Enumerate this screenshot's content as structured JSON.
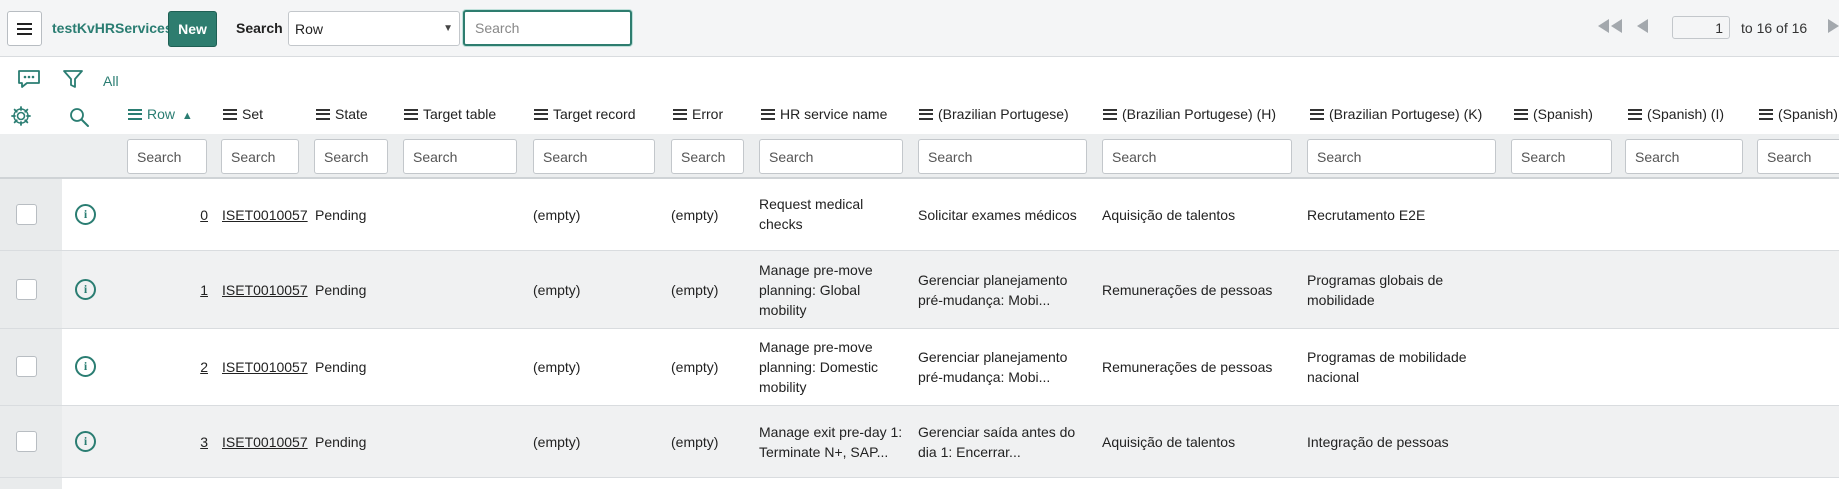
{
  "header": {
    "title": "testKvHRServices",
    "new_label": "New",
    "search_label": "Search",
    "search_field": "Row",
    "search_placeholder": "Search",
    "page_value": "1",
    "page_count": "to 16 of 16"
  },
  "filter": {
    "all_label": "All"
  },
  "columns": [
    {
      "label": "Row",
      "sorted": "asc"
    },
    {
      "label": "Set"
    },
    {
      "label": "State"
    },
    {
      "label": "Target table"
    },
    {
      "label": "Target record"
    },
    {
      "label": "Error"
    },
    {
      "label": "HR service name"
    },
    {
      "label": "(Brazilian Portugese)"
    },
    {
      "label": "(Brazilian Portugese) (H)"
    },
    {
      "label": "(Brazilian Portugese) (K)"
    },
    {
      "label": "(Spanish)"
    },
    {
      "label": "(Spanish) (I)"
    },
    {
      "label": "(Spanish)"
    }
  ],
  "sort_indicator": "▲",
  "column_search_placeholder": "Search",
  "rows": [
    {
      "row": "0",
      "set": "ISET0010057",
      "state": "Pending",
      "target_record": "(empty)",
      "error": "(empty)",
      "name": [
        "Request medical",
        "checks"
      ],
      "br": [
        "Solicitar exames médicos"
      ],
      "br_h": "Aquisição de talentos",
      "br_k": [
        "Recrutamento E2E"
      ]
    },
    {
      "row": "1",
      "set": "ISET0010057",
      "state": "Pending",
      "target_record": "(empty)",
      "error": "(empty)",
      "name": [
        "Manage pre-move",
        "planning: Global",
        "mobility"
      ],
      "br": [
        "Gerenciar planejamento",
        "pré-mudança: Mobi..."
      ],
      "br_h": "Remunerações de pessoas",
      "br_k": [
        "Programas globais de",
        "mobilidade"
      ]
    },
    {
      "row": "2",
      "set": "ISET0010057",
      "state": "Pending",
      "target_record": "(empty)",
      "error": "(empty)",
      "name": [
        "Manage pre-move",
        "planning: Domestic",
        "mobility"
      ],
      "br": [
        "Gerenciar planejamento",
        "pré-mudança: Mobi..."
      ],
      "br_h": "Remunerações de pessoas",
      "br_k": [
        "Programas de mobilidade",
        "nacional"
      ]
    },
    {
      "row": "3",
      "set": "ISET0010057",
      "state": "Pending",
      "target_record": "(empty)",
      "error": "(empty)",
      "name": [
        "Manage exit pre-day 1:",
        "Terminate N+, SAP..."
      ],
      "br": [
        "Gerenciar saída antes do",
        "dia 1: Encerrar..."
      ],
      "br_h": "Aquisição de talentos",
      "br_k": [
        "Integração de pessoas"
      ]
    }
  ],
  "colors": {
    "accent": "#2e7d6f",
    "link": "#2a7d72"
  }
}
